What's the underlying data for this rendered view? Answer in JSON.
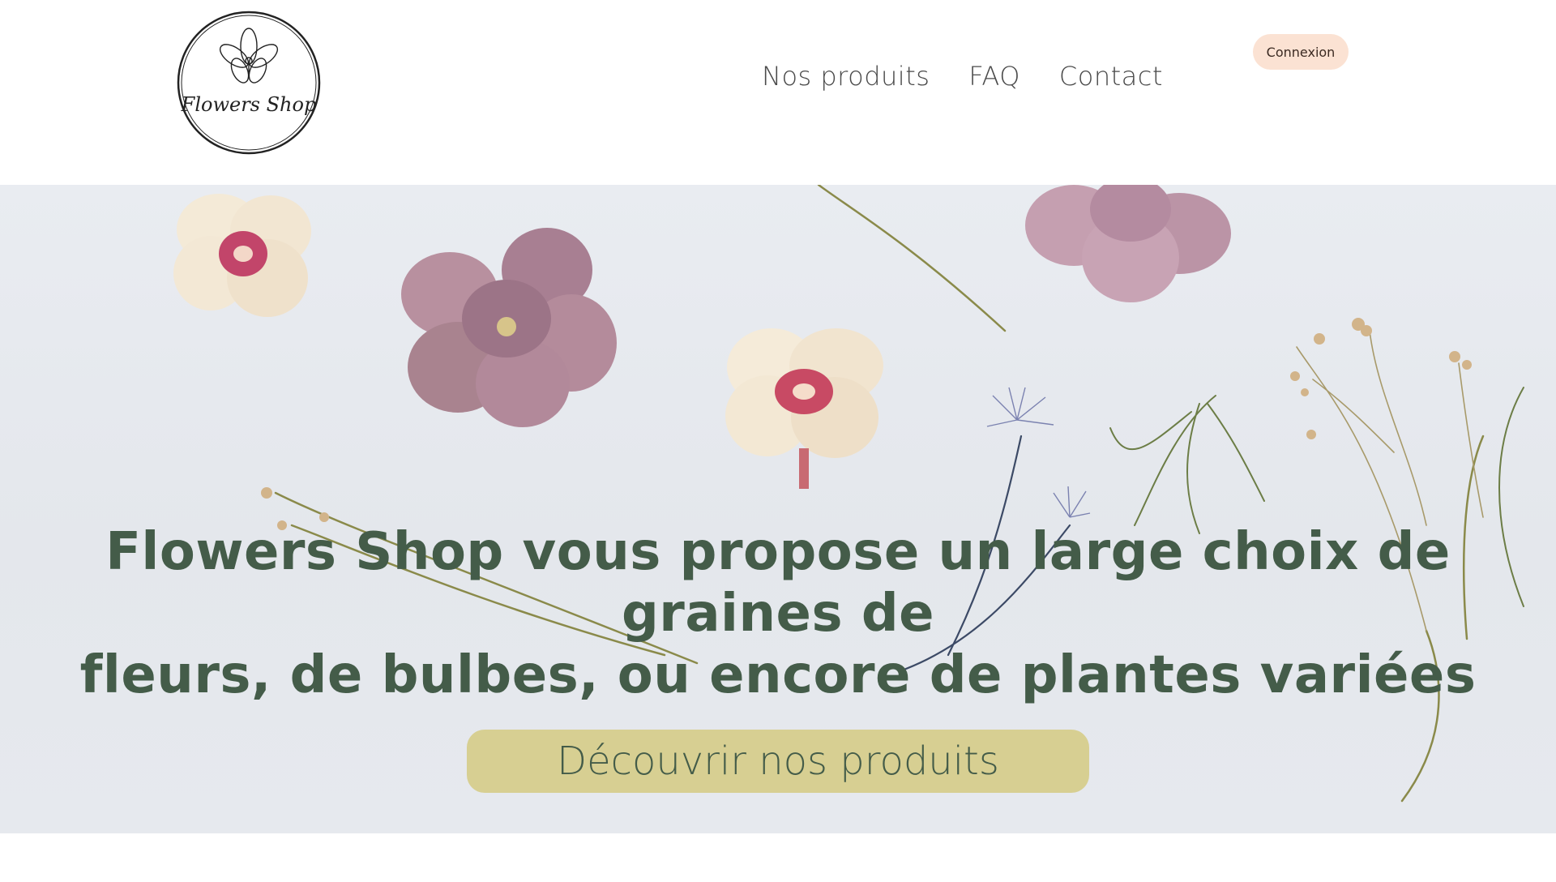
{
  "brand": {
    "logo_text": "Flowers Shop"
  },
  "nav": {
    "items": [
      {
        "label": "Nos produits"
      },
      {
        "label": "FAQ"
      },
      {
        "label": "Contact"
      }
    ],
    "login_label": "Connexion"
  },
  "hero": {
    "headline_line1": "Flowers Shop vous propose un large choix de graines de",
    "headline_line2": "fleurs, de bulbes, ou encore de plantes variées",
    "cta_label": "Découvrir nos produits"
  },
  "colors": {
    "headline": "#445c49",
    "cta_background": "#d7cf92",
    "login_background": "#fbe2d3",
    "hero_background": "#e6e9ee"
  },
  "icons": [
    "flower-logo-icon"
  ]
}
